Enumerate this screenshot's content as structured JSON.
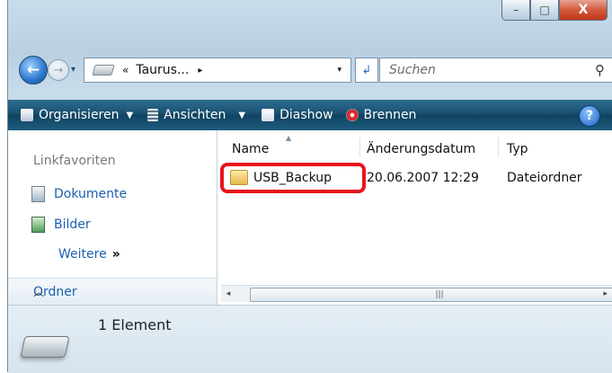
{
  "window": {
    "caption": {
      "minimize": "–",
      "maximize": "□",
      "close": "X"
    }
  },
  "address": {
    "path_prefix": "«",
    "path": "Taurus...",
    "path_arrow": "▸",
    "dropdown": "▾",
    "search_placeholder": "Suchen"
  },
  "toolbar": {
    "items": [
      {
        "label": "Organisieren",
        "icon": "organize-icon",
        "has_dropdown": true
      },
      {
        "label": "Ansichten",
        "icon": "views-icon",
        "has_dropdown": true
      },
      {
        "label": "Diashow",
        "icon": "slideshow-icon",
        "has_dropdown": false
      },
      {
        "label": "Brennen",
        "icon": "burn-icon",
        "has_dropdown": false
      }
    ],
    "help": "?"
  },
  "navpane": {
    "title": "Linkfavoriten",
    "items": [
      {
        "label": "Dokumente",
        "icon": "documents-icon"
      },
      {
        "label": "Bilder",
        "icon": "pictures-icon"
      }
    ],
    "more": "Weitere",
    "more_glyph": "»",
    "folders": "Ordner"
  },
  "filelist": {
    "columns": [
      "Name",
      "Änderungsdatum",
      "Typ"
    ],
    "rows": [
      {
        "name": "USB_Backup",
        "date": "20.06.2007 12:29",
        "type": "Dateiordner",
        "icon": "folder-icon"
      }
    ]
  },
  "details": {
    "count": "1 Element",
    "icon": "drive-icon"
  },
  "colors": {
    "toolbar": "#18506f",
    "link": "#1d5fae",
    "highlight": "#e8141c"
  }
}
